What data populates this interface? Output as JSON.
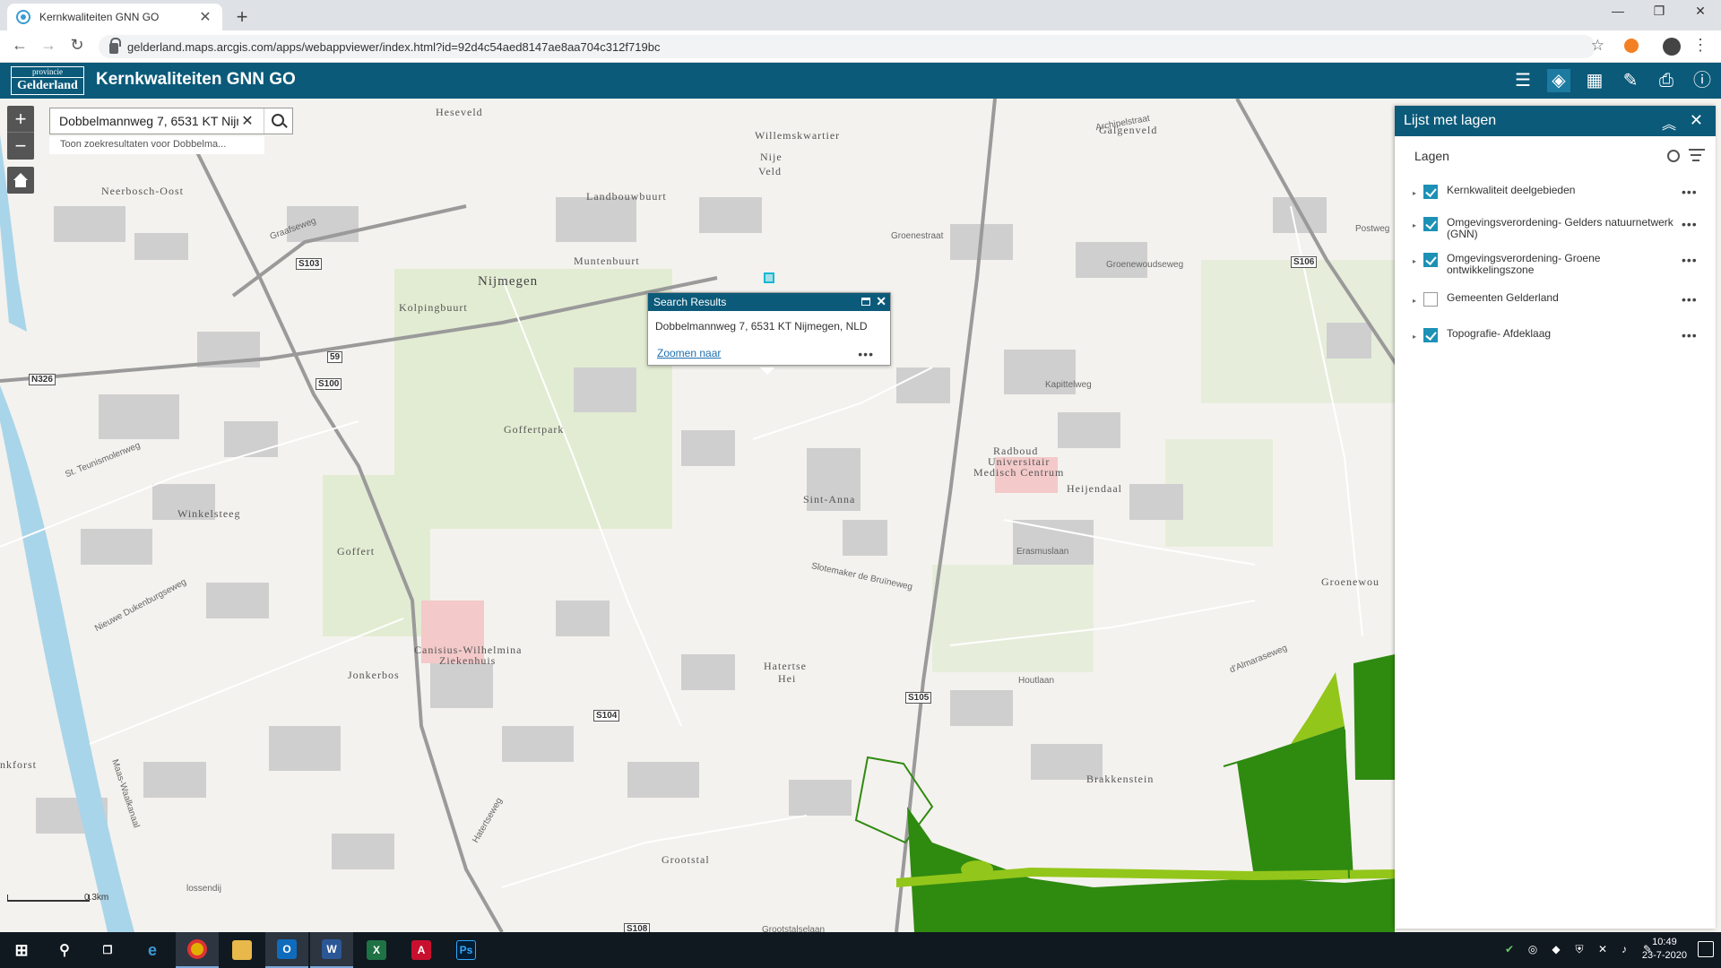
{
  "browser": {
    "tab_title": "Kernkwaliteiten GNN GO",
    "url": "gelderland.maps.arcgis.com/apps/webappviewer/index.html?id=92d4c54aed8147ae8aa704c312f719bc"
  },
  "app": {
    "logo_line1": "provincie",
    "logo_line2": "Gelderland",
    "title": "Kernkwaliteiten GNN GO"
  },
  "search": {
    "value": "Dobbelmannweg 7, 6531 KT Nijmegen, NLD",
    "hint": "Toon zoekresultaten voor Dobbelma..."
  },
  "popup": {
    "title": "Search Results",
    "address": "Dobbelmannweg 7, 6531 KT Nijmegen, NLD",
    "link": "Zoomen naar",
    "more": "•••"
  },
  "panel": {
    "title": "Lijst met lagen",
    "subtitle": "Lagen",
    "layers": [
      {
        "name": "Kernkwaliteit deelgebieden",
        "checked": true
      },
      {
        "name": "Omgevingsverordening- Gelders natuurnetwerk (GNN)",
        "checked": true
      },
      {
        "name": "Omgevingsverordening- Groene ontwikkelingszone",
        "checked": true
      },
      {
        "name": "Gemeenten Gelderland",
        "checked": false
      },
      {
        "name": "Topografie- Afdeklaag",
        "checked": true
      }
    ],
    "more": "•••"
  },
  "map": {
    "scale": "0.3km",
    "labels": {
      "heseveld": "Heseveld",
      "neerbosch": "Neerbosch-Oost",
      "willemskwartier": "Willemskwartier",
      "nije": "Nije",
      "veld": "Veld",
      "galgenveld": "Galgenveld",
      "landbouwbuurt": "Landbouwbuurt",
      "nijmegen": "Nijmegen",
      "muntenbuurt": "Muntenbuurt",
      "kolpingbuurt": "Kolpingbuurt",
      "goffertpark": "Goffertpark",
      "winkelsteeg": "Winkelsteeg",
      "goffert": "Goffert",
      "sintanna": "Sint-Anna",
      "radboud": "Radboud",
      "universitair": "Universitair",
      "medisch": "Medisch Centrum",
      "heijendaal": "Heijendaal",
      "groenewoud": "Groenewou",
      "canisius": "Canisius-Wilhelmina",
      "ziekenhuis": "Ziekenhuis",
      "jonkerbos": "Jonkerbos",
      "hatertse": "Hatertse",
      "hei": "Hei",
      "brakkenstein": "Brakkenstein",
      "grootstal": "Grootstal",
      "nkforst": "nkforst",
      "graafseweg": "Graafseweg",
      "groenestraat": "Groenestraat",
      "archipelstraat": "Archipelstraat",
      "groenewoudseweg": "Groenewoudseweg",
      "kapittelweg": "Kapittelweg",
      "erasmuslaan": "Erasmuslaan",
      "slotemaker": "Slotemaker de Bruïneweg",
      "houtlaan": "Houtlaan",
      "postweg": "Postweg",
      "maaswaal": "Maas-Waalkanaal",
      "teunismolenweg": "St. Teunismolenweg",
      "dukenburg": "Nieuwe Dukenburgseweg",
      "hatertseweg": "Hatertseweg",
      "almaraseweg": "d'Almaraseweg",
      "grootstalselaan": "Grootstalselaan",
      "lossendij": "lossendij"
    },
    "roads": {
      "s103": "S103",
      "s100": "S100",
      "r59": "59",
      "n326": "N326",
      "s104": "S104",
      "s105": "S105",
      "s106": "S106",
      "s108": "S108"
    }
  },
  "taskbar": {
    "time": "10:49",
    "date": "23-7-2020"
  }
}
